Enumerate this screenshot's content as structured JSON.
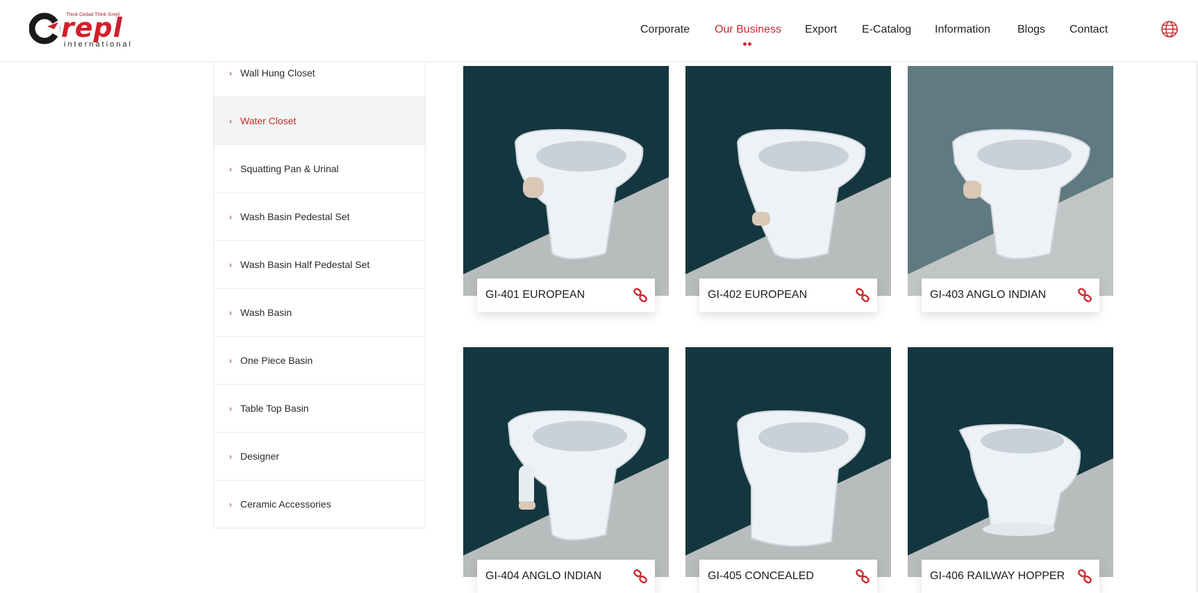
{
  "brand": {
    "tagline": "Think Global Think Grepl",
    "name": "repl",
    "subtitle": "international"
  },
  "nav": {
    "items": [
      {
        "label": "Corporate",
        "active": false
      },
      {
        "label": "Our Business",
        "active": true
      },
      {
        "label": "Export",
        "active": false
      },
      {
        "label": "E-Catalog",
        "active": false
      },
      {
        "label": "Information",
        "active": false
      },
      {
        "label": "Blogs",
        "active": false
      },
      {
        "label": "Contact",
        "active": false
      }
    ],
    "language_icon": "globe-icon"
  },
  "sidebar": {
    "items": [
      {
        "label": "Wall Hung Closet",
        "active": false
      },
      {
        "label": "Water Closet",
        "active": true
      },
      {
        "label": "Squatting Pan & Urinal",
        "active": false
      },
      {
        "label": "Wash Basin Pedestal Set",
        "active": false
      },
      {
        "label": "Wash Basin Half Pedestal Set",
        "active": false
      },
      {
        "label": "Wash Basin",
        "active": false
      },
      {
        "label": "One Piece Basin",
        "active": false
      },
      {
        "label": "Table Top Basin",
        "active": false
      },
      {
        "label": "Designer",
        "active": false
      },
      {
        "label": "Ceramic Accessories",
        "active": false
      }
    ]
  },
  "products": [
    {
      "title": "GI-401 EUROPEAN",
      "icon": "link-icon"
    },
    {
      "title": "GI-402 EUROPEAN",
      "icon": "link-icon"
    },
    {
      "title": "GI-403 ANGLO INDIAN",
      "icon": "link-icon"
    },
    {
      "title": "GI-404 ANGLO INDIAN",
      "icon": "link-icon"
    },
    {
      "title": "GI-405 CONCEALED",
      "icon": "link-icon"
    },
    {
      "title": "GI-406 RAILWAY HOPPER",
      "icon": "link-icon"
    }
  ],
  "colors": {
    "accent": "#c62a2f",
    "product_backdrop": "#14373f",
    "floor": "#b9bcbc"
  }
}
